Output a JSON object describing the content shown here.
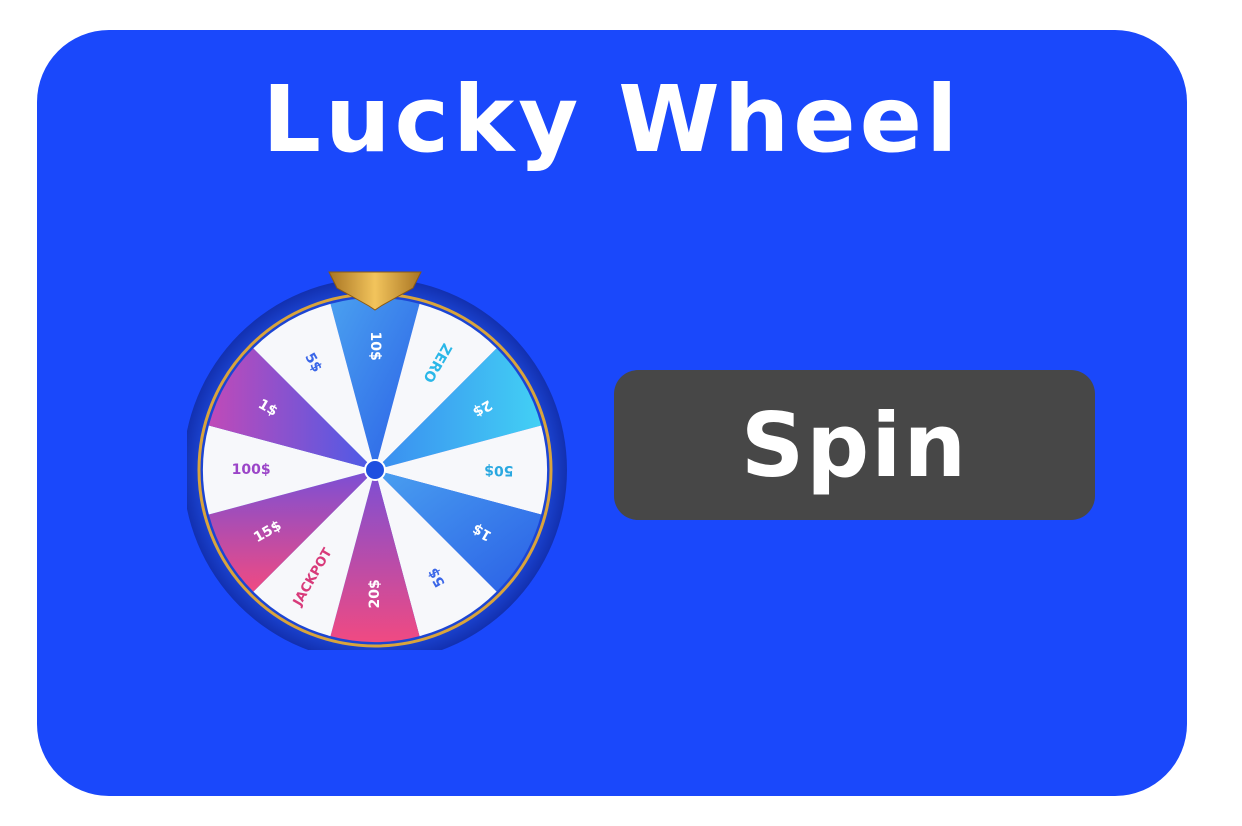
{
  "title": "Lucky Wheel",
  "spin_button": {
    "label": "Spin"
  },
  "wheel": {
    "segments": [
      {
        "label": "10$",
        "style": "blue-gradient",
        "text_color": "#ffffff"
      },
      {
        "label": "ZERO",
        "style": "white",
        "text_color": "#2ab7e8"
      },
      {
        "label": "2$",
        "style": "cyan-gradient",
        "text_color": "#ffffff"
      },
      {
        "label": "50$",
        "style": "white",
        "text_color": "#2aa8e0"
      },
      {
        "label": "1$",
        "style": "blue-gradient",
        "text_color": "#ffffff"
      },
      {
        "label": "5$",
        "style": "white",
        "text_color": "#3a66e8"
      },
      {
        "label": "20$",
        "style": "pink-gradient",
        "text_color": "#ffffff"
      },
      {
        "label": "JACKPOT",
        "style": "white",
        "text_color": "#d83a7a"
      },
      {
        "label": "15$",
        "style": "pink-gradient",
        "text_color": "#ffffff"
      },
      {
        "label": "100$",
        "style": "white",
        "text_color": "#9b45c8"
      },
      {
        "label": "1$",
        "style": "purple-gradient",
        "text_color": "#ffffff"
      },
      {
        "label": "5$",
        "style": "white",
        "text_color": "#3a66e8"
      }
    ],
    "colors": {
      "rim": "#1b3fd6",
      "rim_dark": "#1533b8",
      "gold": "#d9a43c",
      "hub": "#1f4fe0"
    }
  },
  "colors": {
    "card_background": "#1a48fb",
    "button_background": "#474747",
    "text": "#ffffff"
  }
}
